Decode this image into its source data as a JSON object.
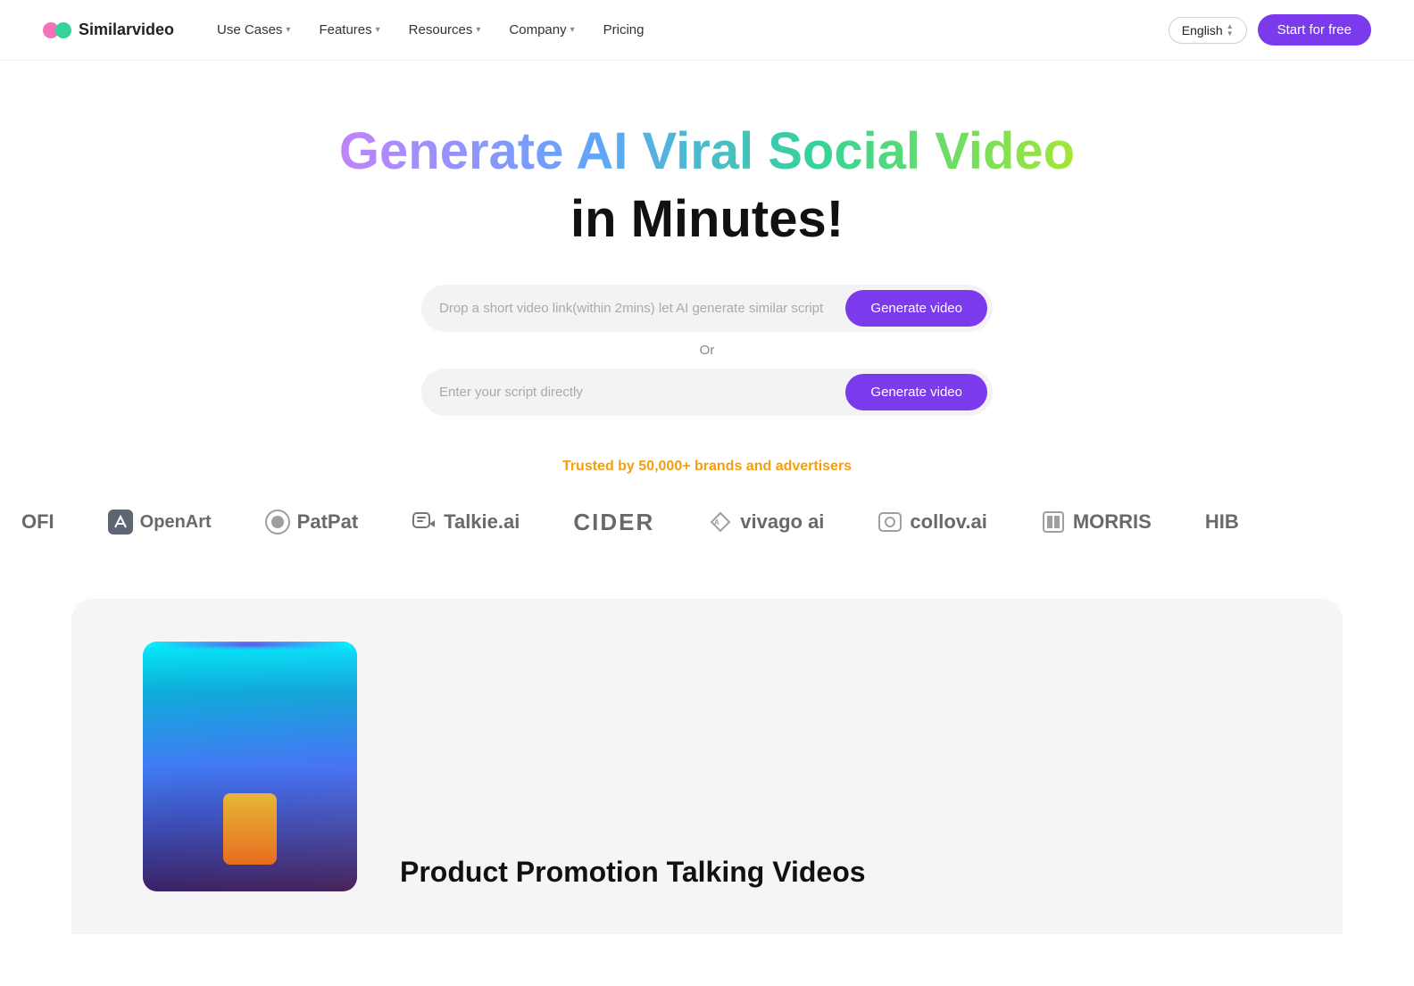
{
  "logo": {
    "name": "Similarvideo"
  },
  "nav": {
    "items": [
      {
        "label": "Use Cases",
        "hasDropdown": true
      },
      {
        "label": "Features",
        "hasDropdown": true
      },
      {
        "label": "Resources",
        "hasDropdown": true
      },
      {
        "label": "Company",
        "hasDropdown": true
      },
      {
        "label": "Pricing",
        "hasDropdown": false
      }
    ]
  },
  "language": {
    "label": "English"
  },
  "cta": {
    "label": "Start for free"
  },
  "hero": {
    "title_gradient": "Generate AI Viral Social Video",
    "title_black": "in Minutes!",
    "input1_placeholder": "Drop a short video link(within 2mins) let AI generate similar script",
    "input2_placeholder": "Enter your script directly",
    "generate_btn1": "Generate video",
    "generate_btn2": "Generate video",
    "or_label": "Or"
  },
  "trust": {
    "text_prefix": "Trusted by ",
    "highlight": "50,000+",
    "text_suffix": " brands and advertisers"
  },
  "brands": [
    {
      "name": "OFI",
      "hasIcon": false
    },
    {
      "name": "OpenArt",
      "hasIcon": true,
      "iconType": "openart"
    },
    {
      "name": "PatPat",
      "hasIcon": true,
      "iconType": "patpat"
    },
    {
      "name": "Talkie.ai",
      "hasIcon": true,
      "iconType": "talkie"
    },
    {
      "name": "CIDER",
      "hasIcon": false
    },
    {
      "name": "vivago ai",
      "hasIcon": true,
      "iconType": "vivago"
    },
    {
      "name": "collov.ai",
      "hasIcon": true,
      "iconType": "collov"
    },
    {
      "name": "MORRIS",
      "hasIcon": true,
      "iconType": "morris"
    },
    {
      "name": "HIB",
      "hasIcon": false
    }
  ],
  "bottom": {
    "section_title": "Product Promotion Talking Videos"
  }
}
